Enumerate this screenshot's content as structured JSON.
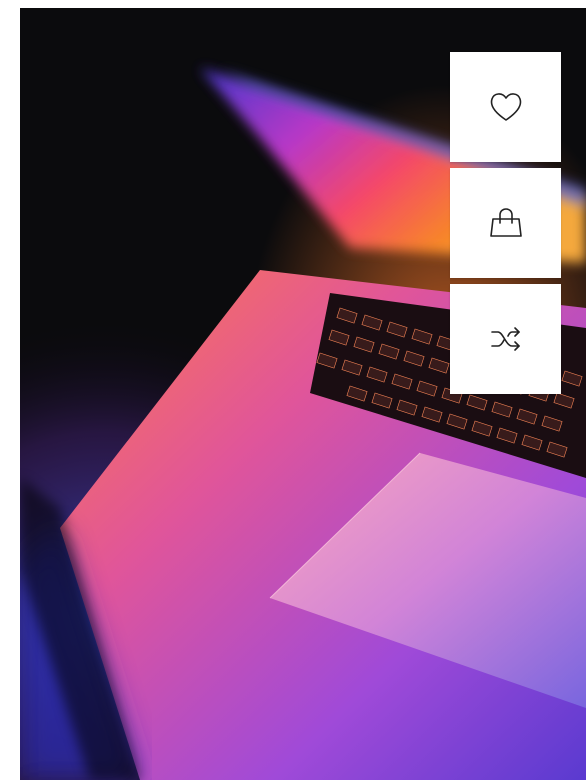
{
  "product_card": {
    "image": {
      "subject": "laptop-keyboard-photo"
    },
    "actions": [
      {
        "name": "wishlist",
        "icon": "heart-icon"
      },
      {
        "name": "add-to-cart",
        "icon": "shopping-bag-icon"
      },
      {
        "name": "compare",
        "icon": "shuffle-icon"
      }
    ]
  },
  "colors": {
    "button_bg": "#ffffff",
    "icon_stroke": "#222222",
    "photo_bg": "#0b0b0d"
  }
}
